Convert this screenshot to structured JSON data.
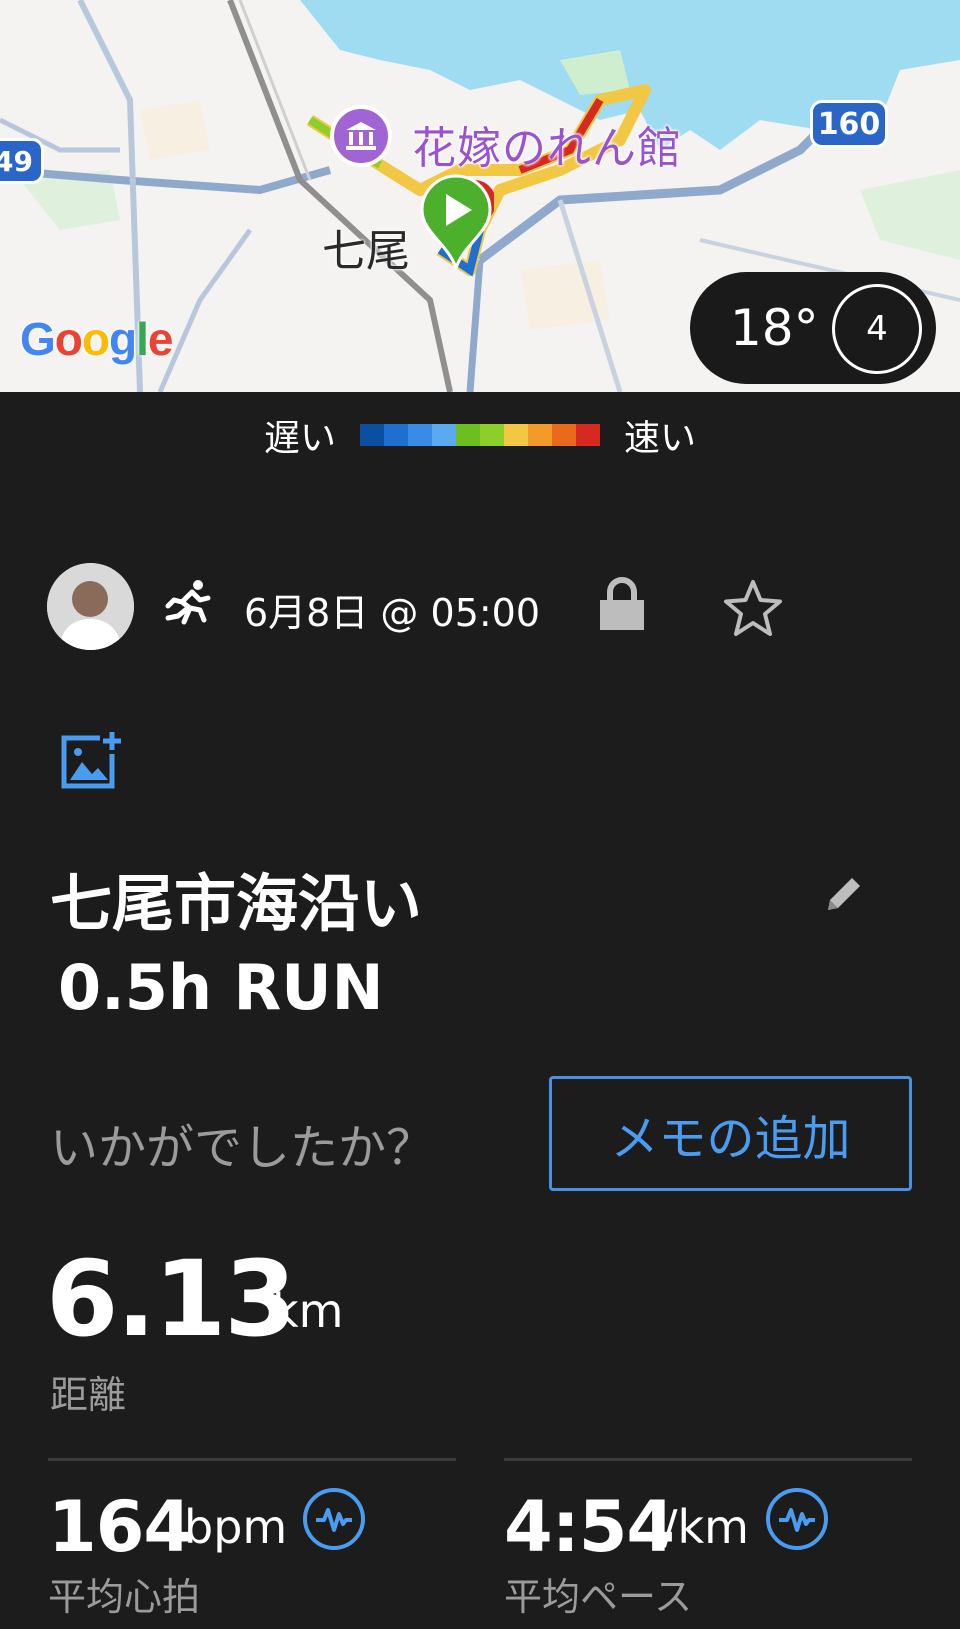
{
  "map": {
    "poi_label": "花嫁のれん館",
    "town_label": "七尾",
    "route_badge_right": "160",
    "route_badge_left": "49",
    "google_logo": "Google",
    "weather_temp": "18°",
    "wind_speed": "4"
  },
  "legend": {
    "slow_label": "遅い",
    "fast_label": "速い",
    "colors": [
      "#0a4fa0",
      "#1f6fd0",
      "#3a8be6",
      "#5aaaf0",
      "#6cbf1e",
      "#8ccf2a",
      "#f2c744",
      "#f29a2a",
      "#ea6a1c",
      "#d62a20"
    ]
  },
  "activity": {
    "icon": "running-icon",
    "date": "6月8日 @ 05:00",
    "title_line1": "七尾市海沿い",
    "title_line2": "0.5h RUN",
    "prompt": "いかがでしたか？",
    "memo_button": "メモの追加"
  },
  "stats": {
    "distance": {
      "value": "6.13",
      "unit": "km",
      "label": "距離"
    },
    "heart_rate": {
      "value": "164",
      "unit": "bpm",
      "label": "平均心拍"
    },
    "pace": {
      "value": "4:54",
      "unit": "/km",
      "label": "平均ペース"
    }
  },
  "colors": {
    "background": "#1c1c1c",
    "accent": "#4a9cf0",
    "muted_text": "#9b9b9b"
  }
}
